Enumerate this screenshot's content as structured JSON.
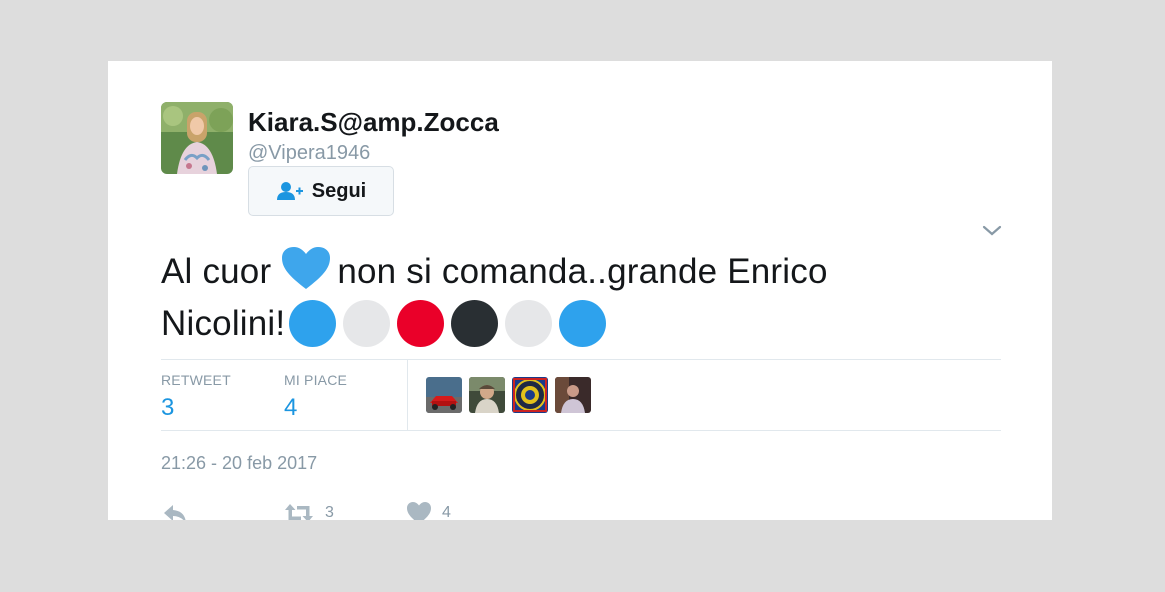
{
  "user": {
    "display_name": "Kiara.S@amp.Zocca",
    "handle": "@Vipera1946",
    "follow_label": "Segui"
  },
  "tweet": {
    "text_part1": "Al cuor",
    "text_part2": "non si comanda..grande Enrico",
    "text_part3": "Nicolini!",
    "emoji_heart_color": "#3ea6ec",
    "emoji_circles": [
      "#2ea2ed",
      "#e6e7e9",
      "#ea0029",
      "#292f33",
      "#e6e7e9",
      "#2ea2ed"
    ]
  },
  "stats": {
    "retweet_label": "RETWEET",
    "retweet_count": "3",
    "likes_label": "MI PIACE",
    "likes_count": "4"
  },
  "timestamp": "21:26 - 20 feb 2017",
  "actions": {
    "retweet_count": "3",
    "like_count": "4"
  },
  "icons": {
    "follow": "add-user-icon",
    "menu": "chevron-down-icon",
    "reply": "reply-icon",
    "retweet": "retweet-icon",
    "like": "heart-icon"
  },
  "colors": {
    "background": "#dddddd",
    "card": "#ffffff",
    "link_blue": "#1b95e0",
    "muted": "#8899a6"
  }
}
